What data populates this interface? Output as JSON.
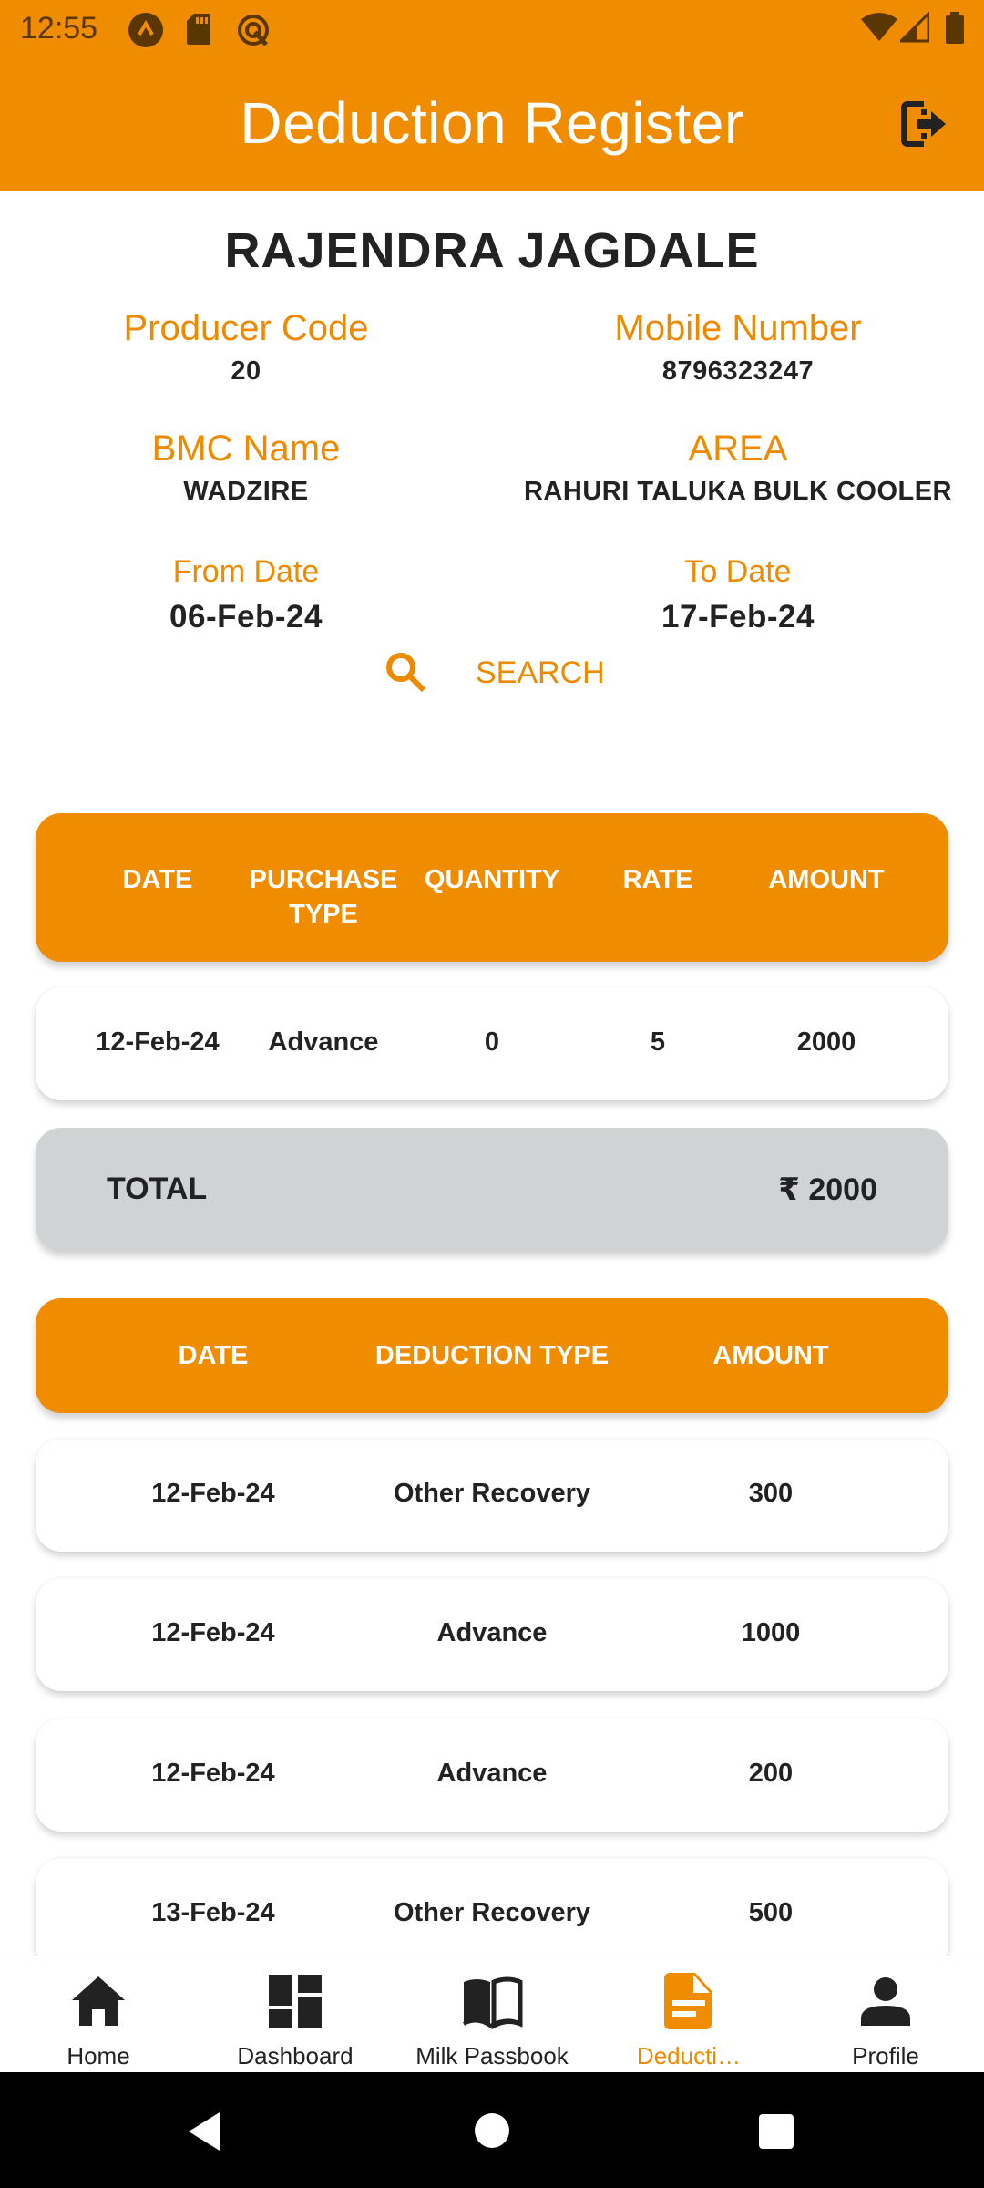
{
  "status_bar": {
    "time": "12:55",
    "left_icons": [
      "app-notification-icon",
      "sd-card-icon",
      "vpn-key-icon"
    ],
    "right_icons": [
      "wifi-icon",
      "cell-signal-icon",
      "battery-icon"
    ]
  },
  "app_bar": {
    "title": "Deduction Register",
    "action_icon": "logout-icon"
  },
  "producer": {
    "name": "RAJENDRA JAGDALE",
    "fields": [
      {
        "label": "Producer Code",
        "value": "20"
      },
      {
        "label": "Mobile Number",
        "value": "8796323247"
      },
      {
        "label": "BMC Name",
        "value": "WADZIRE"
      },
      {
        "label": "AREA",
        "value": "RAHURI TALUKA BULK COOLER"
      }
    ],
    "from_date": {
      "label": "From Date",
      "value": "06-Feb-24"
    },
    "to_date": {
      "label": "To Date",
      "value": "17-Feb-24"
    }
  },
  "search": {
    "label": "SEARCH",
    "icon": "search-icon"
  },
  "purchase_table": {
    "headers": [
      "DATE",
      "PURCHASE TYPE",
      "QUANTITY",
      "RATE",
      "AMOUNT"
    ],
    "rows": [
      [
        "12-Feb-24",
        "Advance",
        "0",
        "5",
        "2000"
      ]
    ]
  },
  "total": {
    "label": "TOTAL",
    "value": "₹ 2000"
  },
  "deduction_table": {
    "headers": [
      "DATE",
      "DEDUCTION TYPE",
      "AMOUNT"
    ],
    "rows": [
      [
        "12-Feb-24",
        "Other Recovery",
        "300"
      ],
      [
        "12-Feb-24",
        "Advance",
        "1000"
      ],
      [
        "12-Feb-24",
        "Advance",
        "200"
      ],
      [
        "13-Feb-24",
        "Other Recovery",
        "500"
      ]
    ]
  },
  "bottom_nav": {
    "items": [
      {
        "label": "Home",
        "icon": "home-icon"
      },
      {
        "label": "Dashboard",
        "icon": "dashboard-icon"
      },
      {
        "label": "Milk Passbook",
        "icon": "book-icon"
      },
      {
        "label": "Deducti…",
        "icon": "document-icon",
        "active": true
      },
      {
        "label": "Profile",
        "icon": "person-icon"
      }
    ]
  },
  "colors": {
    "accent": "#F08C00",
    "accent_text": "#EE8A00",
    "total_bg": "#D0D3D4",
    "text": "#222222"
  }
}
